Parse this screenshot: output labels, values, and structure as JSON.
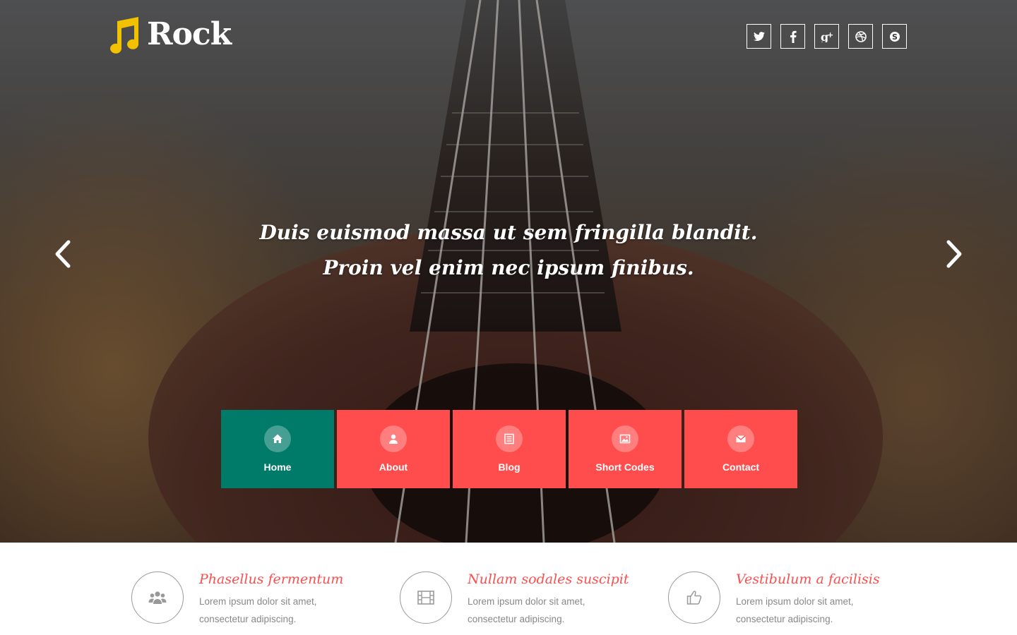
{
  "brand": {
    "name": "Rock",
    "accent": "#f2c200"
  },
  "social": [
    {
      "icon": "twitter-icon",
      "glyph": "t"
    },
    {
      "icon": "facebook-icon",
      "glyph": "f"
    },
    {
      "icon": "google-plus-icon",
      "glyph": "g+"
    },
    {
      "icon": "dribbble-icon",
      "glyph": "⊛"
    },
    {
      "icon": "skype-icon",
      "glyph": "S"
    }
  ],
  "slider": {
    "line1": "Duis euismod massa ut sem fringilla blandit.",
    "line2": "Proin vel enim nec ipsum finibus."
  },
  "nav": [
    {
      "label": "Home",
      "icon": "home-icon",
      "active": true
    },
    {
      "label": "About",
      "icon": "user-icon",
      "active": false
    },
    {
      "label": "Blog",
      "icon": "list-icon",
      "active": false
    },
    {
      "label": "Short Codes",
      "icon": "image-icon",
      "active": false
    },
    {
      "label": "Contact",
      "icon": "mail-icon",
      "active": false
    }
  ],
  "colors": {
    "nav_active": "#007b6a",
    "nav_default": "#ff4d4d",
    "feature_title": "#ff4d4d"
  },
  "features": [
    {
      "icon": "users-icon",
      "title": "Phasellus fermentum",
      "desc": "Lorem ipsum dolor sit amet, consectetur adipiscing."
    },
    {
      "icon": "film-icon",
      "title": "Nullam sodales suscipit",
      "desc": "Lorem ipsum dolor sit amet, consectetur adipiscing."
    },
    {
      "icon": "thumbs-up-icon",
      "title": "Vestibulum a facilisis",
      "desc": "Lorem ipsum dolor sit amet, consectetur adipiscing."
    }
  ]
}
